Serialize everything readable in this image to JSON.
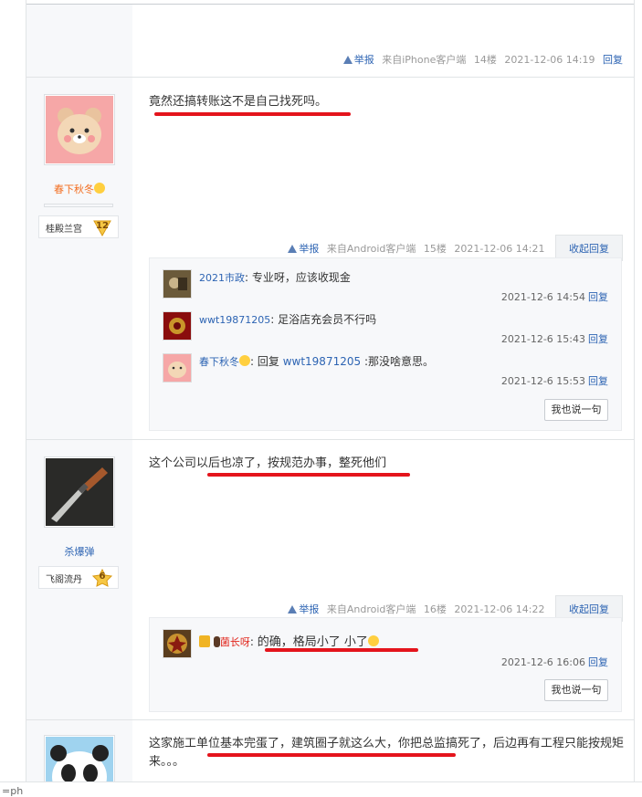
{
  "post14": {
    "report": "举报",
    "source": "来自iPhone客户端",
    "floor": "14楼",
    "time": "2021-12-06 14:19",
    "reply": "回复"
  },
  "post15": {
    "username": "春下秋冬",
    "level_name": "桂殿兰宫",
    "level": "12",
    "content": "竟然还搞转账这不是自己找死吗。",
    "report": "举报",
    "source": "来自Android客户端",
    "floor": "15楼",
    "time": "2021-12-06 14:21",
    "collapse": "收起回复",
    "replies": [
      {
        "user": "2021市政",
        "text": "专业呀，应该收现金",
        "time": "2021-12-6 14:54",
        "reply": "回复"
      },
      {
        "user": "wwt19871205",
        "text": "足浴店充会员不行吗",
        "time": "2021-12-6 15:43",
        "reply": "回复"
      },
      {
        "user": "春下秋冬",
        "reply_prefix": "回复",
        "reply_to": "wwt19871205",
        "text": ":那没啥意思。",
        "time": "2021-12-6 15:53",
        "reply": "回复"
      }
    ],
    "say": "我也说一句"
  },
  "post16": {
    "username": "杀爆弹",
    "level_name": "飞阁流丹",
    "level": "6",
    "content": "这个公司以后也凉了，按规范办事，整死他们",
    "report": "举报",
    "source": "来自Android客户端",
    "floor": "16楼",
    "time": "2021-12-06 14:22",
    "collapse": "收起回复",
    "replies": [
      {
        "user": "菌长呀",
        "text": "的确，格局小了 小了",
        "time": "2021-12-6 16:06",
        "reply": "回复"
      }
    ],
    "say": "我也说一句"
  },
  "post17": {
    "content": "这家施工单位基本完蛋了，建筑圈子就这么大，你把总监搞死了，后边再有工程只能按规矩来。。。"
  },
  "footer": {
    "text": "=ph"
  },
  "colors": {
    "link": "#2d64b3",
    "accent": "#f36f22",
    "annotation": "#e4141c"
  }
}
